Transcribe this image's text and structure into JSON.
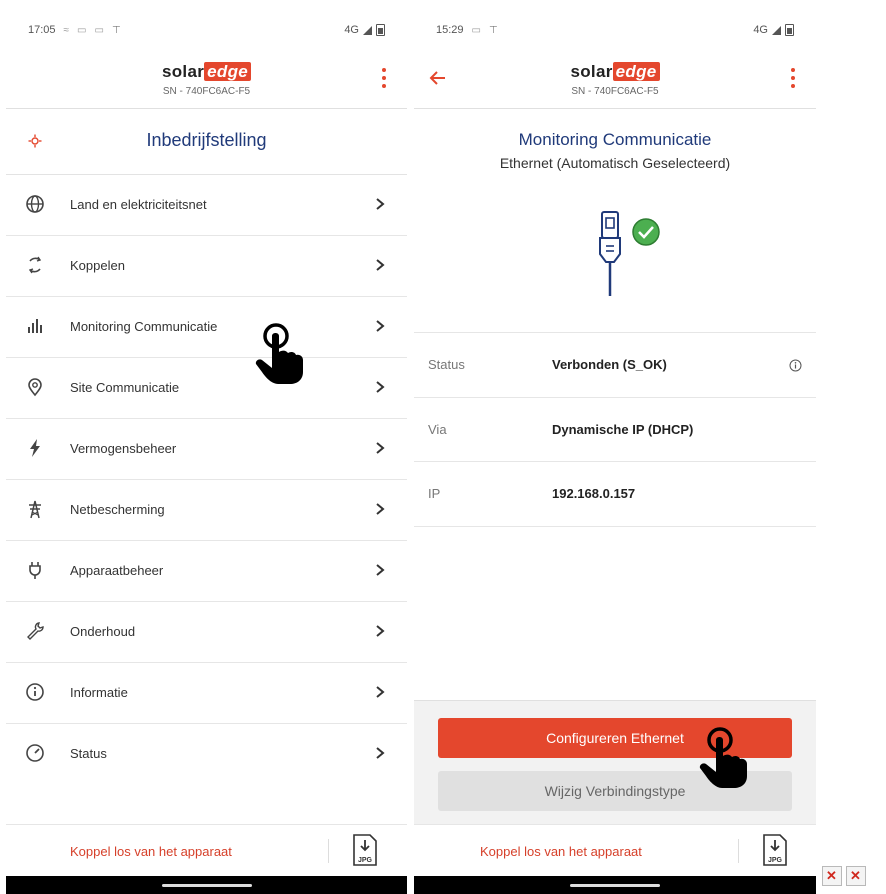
{
  "left": {
    "status_time": "17:05",
    "status_network": "4G",
    "logo_solar": "solar",
    "logo_edge": "edge",
    "serial": "SN - 740FC6AC-F5",
    "section_title": "Inbedrijfstelling",
    "menu": [
      {
        "label": "Land en elektriciteitsnet",
        "icon": "globe-icon"
      },
      {
        "label": "Koppelen",
        "icon": "sync-icon"
      },
      {
        "label": "Monitoring Communicatie",
        "icon": "bar-chart-icon"
      },
      {
        "label": "Site Communicatie",
        "icon": "location-pin-icon"
      },
      {
        "label": "Vermogensbeheer",
        "icon": "lightning-icon"
      },
      {
        "label": "Netbescherming",
        "icon": "power-tower-icon"
      },
      {
        "label": "Apparaatbeheer",
        "icon": "plug-icon"
      },
      {
        "label": "Onderhoud",
        "icon": "wrench-icon"
      },
      {
        "label": "Informatie",
        "icon": "info-icon"
      },
      {
        "label": "Status",
        "icon": "gauge-icon"
      }
    ],
    "footer_link": "Koppel los van het apparaat",
    "jpg_label": "JPG"
  },
  "right": {
    "status_time": "15:29",
    "status_network": "4G",
    "logo_solar": "solar",
    "logo_edge": "edge",
    "serial": "SN - 740FC6AC-F5",
    "title": "Monitoring Communicatie",
    "subtitle": "Ethernet (Automatisch Geselecteerd)",
    "rows": [
      {
        "key": "Status",
        "value": "Verbonden (S_OK)"
      },
      {
        "key": "Via",
        "value": "Dynamische IP (DHCP)"
      },
      {
        "key": "IP",
        "value": "192.168.0.157"
      }
    ],
    "primary_button": "Configureren Ethernet",
    "secondary_button": "Wijzig Verbindingstype",
    "footer_link": "Koppel los van het apparaat",
    "jpg_label": "JPG"
  },
  "colors": {
    "accent": "#e4472d",
    "title_blue": "#203a7a",
    "success_green": "#4caf50"
  }
}
